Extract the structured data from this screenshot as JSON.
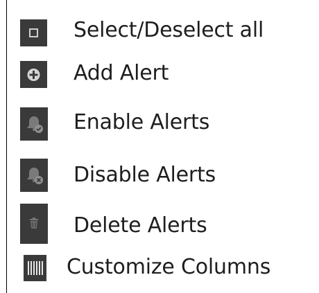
{
  "menu": {
    "items": [
      {
        "label": "Select/Deselect all",
        "icon": "checkbox-icon"
      },
      {
        "label": "Add Alert",
        "icon": "plus-circle-icon"
      },
      {
        "label": "Enable Alerts",
        "icon": "bell-check-icon"
      },
      {
        "label": "Disable Alerts",
        "icon": "bell-x-icon"
      },
      {
        "label": "Delete Alerts",
        "icon": "trash-icon"
      },
      {
        "label": "Customize Columns",
        "icon": "columns-icon"
      }
    ]
  },
  "colors": {
    "icon_background": "#3a3a3a",
    "icon_glyph": "#bfbfbf",
    "text": "#1e1e1e",
    "border": "#000000"
  }
}
